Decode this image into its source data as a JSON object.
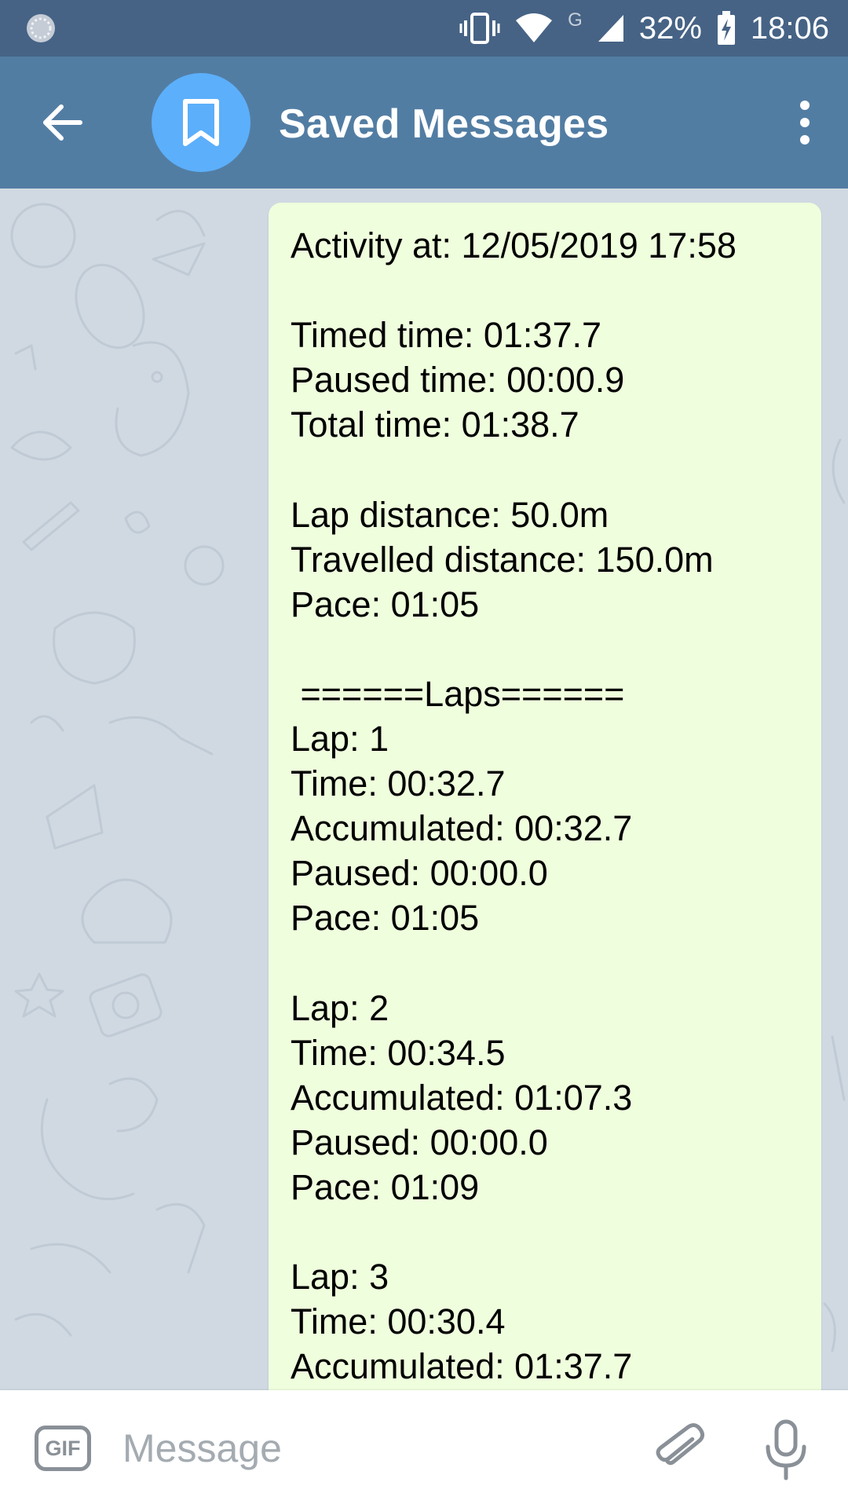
{
  "status_bar": {
    "battery": "32%",
    "network": "G",
    "time": "18:06"
  },
  "header": {
    "back_icon": "arrow-left-icon",
    "avatar_icon": "bookmark-icon",
    "title": "Saved Messages",
    "menu_icon": "more-vertical-icon",
    "color": "#527da3"
  },
  "message": {
    "lines": [
      "Activity at: 12/05/2019 17:58",
      "",
      "Timed time: 01:37.7",
      "Paused time: 00:00.9",
      "Total time: 01:38.7",
      "",
      "Lap distance: 50.0m",
      "Travelled distance: 150.0m",
      "Pace: 01:05",
      "",
      " ======Laps======",
      "Lap: 1",
      "Time: 00:32.7",
      "Accumulated: 00:32.7",
      "Paused: 00:00.0",
      "Pace: 01:05",
      "",
      "Lap: 2",
      "Time: 00:34.5",
      "Accumulated: 01:07.3",
      "Paused: 00:00.0",
      "Pace: 01:09",
      "",
      "Lap: 3",
      "Time: 00:30.4",
      "Accumulated: 01:37.7"
    ],
    "bubble_color": "#effedd"
  },
  "input_bar": {
    "gif_label": "GIF",
    "placeholder": "Message",
    "attach_icon": "paperclip-icon",
    "mic_icon": "microphone-icon"
  }
}
